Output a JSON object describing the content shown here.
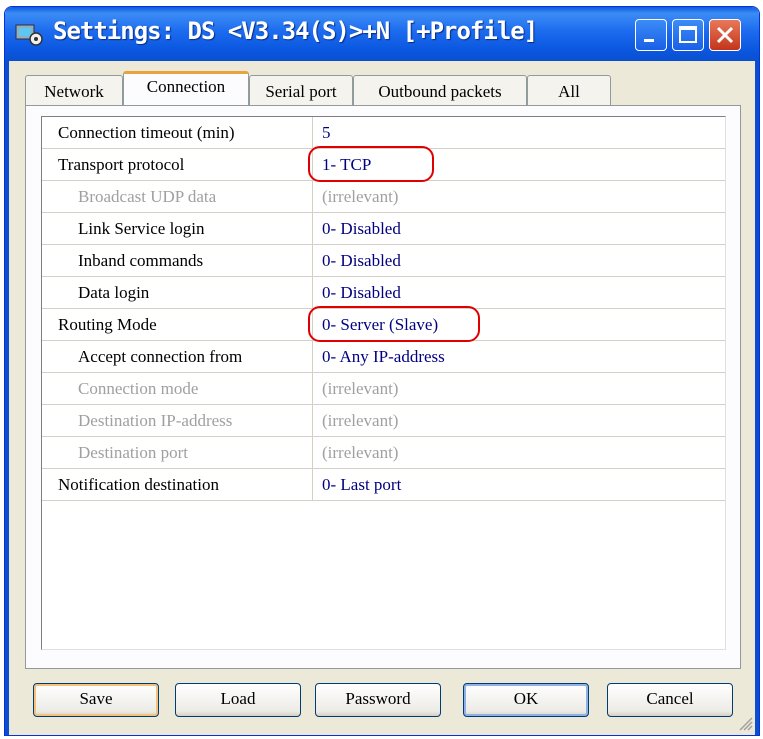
{
  "window": {
    "title": "Settings: DS <V3.34(S)>+N [+Profile]"
  },
  "tabs": [
    {
      "label": "Network"
    },
    {
      "label": "Connection"
    },
    {
      "label": "Serial port"
    },
    {
      "label": "Outbound packets"
    },
    {
      "label": "All"
    }
  ],
  "active_tab": "Connection",
  "rows": [
    {
      "name": "Connection timeout (min)",
      "value": "5",
      "level": 0,
      "enabled": true
    },
    {
      "name": "Transport protocol",
      "value": "1- TCP",
      "level": 0,
      "enabled": true,
      "highlighted": true
    },
    {
      "name": "Broadcast UDP data",
      "value": "(irrelevant)",
      "level": 1,
      "enabled": false
    },
    {
      "name": "Link Service login",
      "value": "0- Disabled",
      "level": 1,
      "enabled": true
    },
    {
      "name": "Inband commands",
      "value": "0- Disabled",
      "level": 1,
      "enabled": true
    },
    {
      "name": "Data login",
      "value": "0- Disabled",
      "level": 1,
      "enabled": true
    },
    {
      "name": "Routing Mode",
      "value": "0- Server (Slave)",
      "level": 0,
      "enabled": true,
      "highlighted": true
    },
    {
      "name": "Accept connection from",
      "value": "0- Any IP-address",
      "level": 1,
      "enabled": true
    },
    {
      "name": "Connection mode",
      "value": "(irrelevant)",
      "level": 1,
      "enabled": false
    },
    {
      "name": "Destination IP-address",
      "value": "(irrelevant)",
      "level": 1,
      "enabled": false
    },
    {
      "name": "Destination port",
      "value": "(irrelevant)",
      "level": 1,
      "enabled": false
    },
    {
      "name": "Notification destination",
      "value": "0- Last port",
      "level": 0,
      "enabled": true
    }
  ],
  "buttons": {
    "save": "Save",
    "load": "Load",
    "password": "Password",
    "ok": "OK",
    "cancel": "Cancel"
  },
  "colors": {
    "value_text": "#000080",
    "disabled_text": "#a0a0a0",
    "highlight_circle": "#e00000",
    "title_bar": "#0a5de0"
  }
}
